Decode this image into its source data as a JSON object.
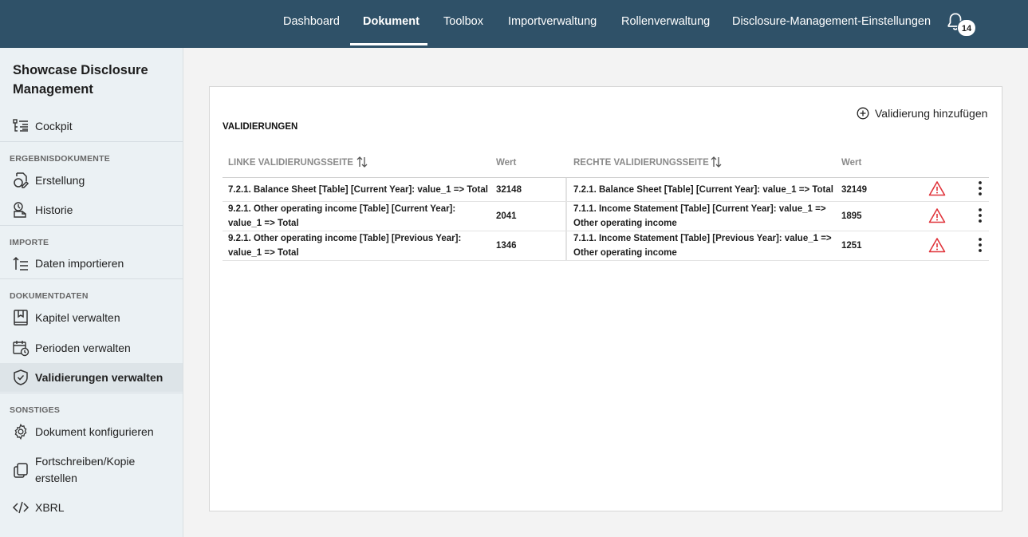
{
  "nav": {
    "items": [
      "Dashboard",
      "Dokument",
      "Toolbox",
      "Importverwaltung",
      "Rollenverwaltung",
      "Disclosure-Management-Einstellungen"
    ],
    "active": "Dokument",
    "notification_count": "14"
  },
  "sidebar": {
    "title": "Showcase Disclosure Management",
    "cockpit": "Cockpit",
    "sections": {
      "ergebnis": "ERGEBNISDOKUMENTE",
      "importe": "IMPORTE",
      "dokumentdaten": "DOKUMENTDATEN",
      "sonstiges": "SONSTIGES"
    },
    "items": {
      "erstellung": "Erstellung",
      "historie": "Historie",
      "daten_importieren": "Daten importieren",
      "kapitel": "Kapitel verwalten",
      "perioden": "Perioden verwalten",
      "validierungen": "Validierungen verwalten",
      "konfigurieren": "Dokument konfigurieren",
      "fortschreiben": "Fortschreiben/Kopie erstellen",
      "xbrl": "XBRL"
    },
    "active": "validierungen"
  },
  "main": {
    "title": "VALIDIERUNGEN",
    "add_label": "Validierung hinzufügen",
    "columns": {
      "left": "LINKE VALIDIERUNGSSEITE",
      "left_value": "Wert",
      "right": "RECHTE VALIDIERUNGSSEITE",
      "right_value": "Wert"
    },
    "rows": [
      {
        "left": "7.2.1. Balance Sheet [Table] [Current Year]: value_1 => Total",
        "left_value": "32148",
        "right": "7.2.1. Balance Sheet [Table] [Current Year]: value_1 => Total",
        "right_value": "32149",
        "status": "warning-icon"
      },
      {
        "left": "9.2.1. Other operating income [Table] [Current Year]: value_1 => Total",
        "left_value": "2041",
        "right": "7.1.1. Income Statement [Table] [Current Year]: value_1 => Other operating income",
        "right_value": "1895",
        "status": "warning-icon"
      },
      {
        "left": "9.2.1. Other operating income [Table] [Previous Year]: value_1 => Total",
        "left_value": "1346",
        "right": "7.1.1. Income Statement [Table] [Previous Year]: value_1 => Other operating income",
        "right_value": "1251",
        "status": "warning-icon"
      }
    ]
  },
  "colors": {
    "topbar": "#2f5168",
    "sidebar": "#ebf1f4",
    "warning": "#e0333a"
  }
}
